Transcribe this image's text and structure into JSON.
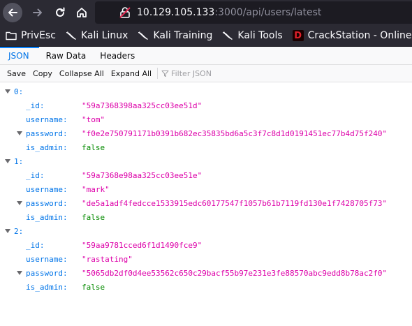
{
  "browser": {
    "url_host": "10.129.105.133",
    "url_rest": ":3000/api/users/latest",
    "bookmarks": [
      {
        "label": "PrivEsc",
        "icon": "folder-icon"
      },
      {
        "label": "Kali Linux",
        "icon": "kali-dragon-icon"
      },
      {
        "label": "Kali Training",
        "icon": "kali-dragon-icon"
      },
      {
        "label": "Kali Tools",
        "icon": "kali-dragon-icon"
      },
      {
        "label": "CrackStation - Online ...",
        "icon": "crackstation-icon"
      }
    ],
    "crack_letter": "D"
  },
  "viewer": {
    "tabs": [
      "JSON",
      "Raw Data",
      "Headers"
    ],
    "toolbar": {
      "save": "Save",
      "copy": "Copy",
      "collapse_all": "Collapse All",
      "expand_all": "Expand All",
      "filter_placeholder": "Filter JSON"
    },
    "users": [
      {
        "index": "0:",
        "fields": [
          {
            "key": "_id:",
            "value": "\"59a7368398aa325cc03ee51d\"",
            "type": "str"
          },
          {
            "key": "username:",
            "value": "\"tom\"",
            "type": "str"
          },
          {
            "key": "password:",
            "value": "\"f0e2e750791171b0391b682ec35835bd6a5c3f7c8d1d0191451ec77b4d75f240\"",
            "type": "str"
          },
          {
            "key": "is_admin:",
            "value": "false",
            "type": "bool"
          }
        ]
      },
      {
        "index": "1:",
        "fields": [
          {
            "key": "_id:",
            "value": "\"59a7368e98aa325cc03ee51e\"",
            "type": "str"
          },
          {
            "key": "username:",
            "value": "\"mark\"",
            "type": "str"
          },
          {
            "key": "password:",
            "value": "\"de5a1adf4fedcce1533915edc60177547f1057b61b7119fd130e1f7428705f73\"",
            "type": "str"
          },
          {
            "key": "is_admin:",
            "value": "false",
            "type": "bool"
          }
        ]
      },
      {
        "index": "2:",
        "fields": [
          {
            "key": "_id:",
            "value": "\"59aa9781cced6f1d1490fce9\"",
            "type": "str"
          },
          {
            "key": "username:",
            "value": "\"rastating\"",
            "type": "str"
          },
          {
            "key": "password:",
            "value": "\"5065db2df0d4ee53562c650c29bacf55b97e231e3fe88570abc9edd8b78ac2f0\"",
            "type": "str"
          },
          {
            "key": "is_admin:",
            "value": "false",
            "type": "bool"
          }
        ]
      }
    ]
  },
  "colors": {
    "chrome_bg": "#2b2a33",
    "url_bg": "#1c1b22",
    "accent": "#0074e8",
    "string": "#dd00a9",
    "boolean": "#058b00"
  }
}
